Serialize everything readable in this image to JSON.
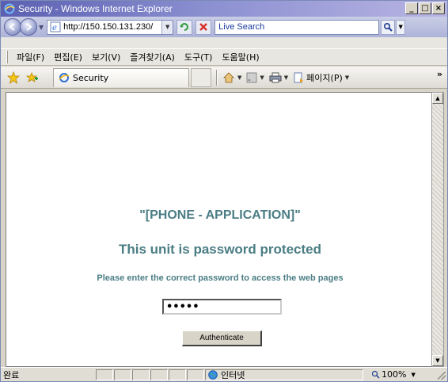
{
  "window": {
    "title": "Security - Windows Internet Explorer",
    "controls": [
      "_",
      "□",
      "×"
    ]
  },
  "address_bar": {
    "url": "http://150.150.131.230/",
    "search_placeholder": "Live Search"
  },
  "menu": {
    "items": [
      "파일(F)",
      "편집(E)",
      "보기(V)",
      "즐겨찾기(A)",
      "도구(T)",
      "도움말(H)"
    ]
  },
  "command_bar": {
    "tab_title": "Security",
    "page_label": "페이지(P)",
    "chevron": "»"
  },
  "content": {
    "heading": "\"[PHONE - APPLICATION]\"",
    "subheading": "This unit is password protected",
    "instruction": "Please enter the correct password to access the web pages",
    "password_value": "•••••",
    "authenticate_label": "Authenticate"
  },
  "status_bar": {
    "status": "완료",
    "zone": "인터넷",
    "zoom": "100%"
  },
  "colors": {
    "accent_text": "#4a7d84",
    "title_bar_start": "#5a5fb0",
    "title_bar_end": "#b8b4e4",
    "chrome": "#d9d4c8"
  }
}
